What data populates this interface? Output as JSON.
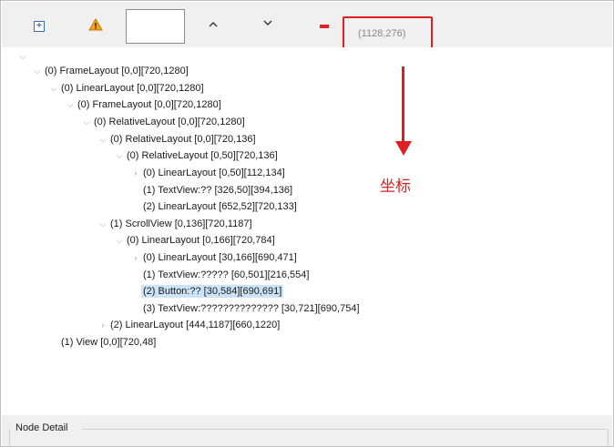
{
  "toolbar": {
    "expand_icon": "expand-all-icon",
    "warning_icon": "warning-icon",
    "up_icon": "chevron-up-icon",
    "down_icon": "chevron-down-icon",
    "coordinate_readout": "(1128,276)"
  },
  "annotation": {
    "label": "坐标",
    "color": "#e02020"
  },
  "tree": {
    "root_toggle": "⌵",
    "rows": [
      {
        "text": "(0) FrameLayout [0,0][720,1280]"
      },
      {
        "text": "(0) LinearLayout [0,0][720,1280]"
      },
      {
        "text": "(0) FrameLayout [0,0][720,1280]"
      },
      {
        "text": "(0) RelativeLayout [0,0][720,1280]"
      },
      {
        "text": "(0) RelativeLayout [0,0][720,136]"
      },
      {
        "text": "(0) RelativeLayout [0,50][720,136]"
      },
      {
        "text": "(0) LinearLayout [0,50][112,134]"
      },
      {
        "text": "(1) TextView:?? [326,50][394,136]"
      },
      {
        "text": "(2) LinearLayout [652,52][720,133]"
      },
      {
        "text": "(1) ScrollView [0,136][720,1187]"
      },
      {
        "text": "(0) LinearLayout [0,166][720,784]"
      },
      {
        "text": "(0) LinearLayout [30,166][690,471]"
      },
      {
        "text": "(1) TextView:????? [60,501][216,554]"
      },
      {
        "text": "(2) Button:?? [30,584][690,691]"
      },
      {
        "text": "(3) TextView:?????????????? [30,721][690,754]"
      },
      {
        "text": "(2) LinearLayout [444,1187][660,1220]"
      },
      {
        "text": "(1) View [0,0][720,48]"
      }
    ],
    "selected_color": "#cce4f7"
  },
  "detail": {
    "title": "Node Detail"
  }
}
